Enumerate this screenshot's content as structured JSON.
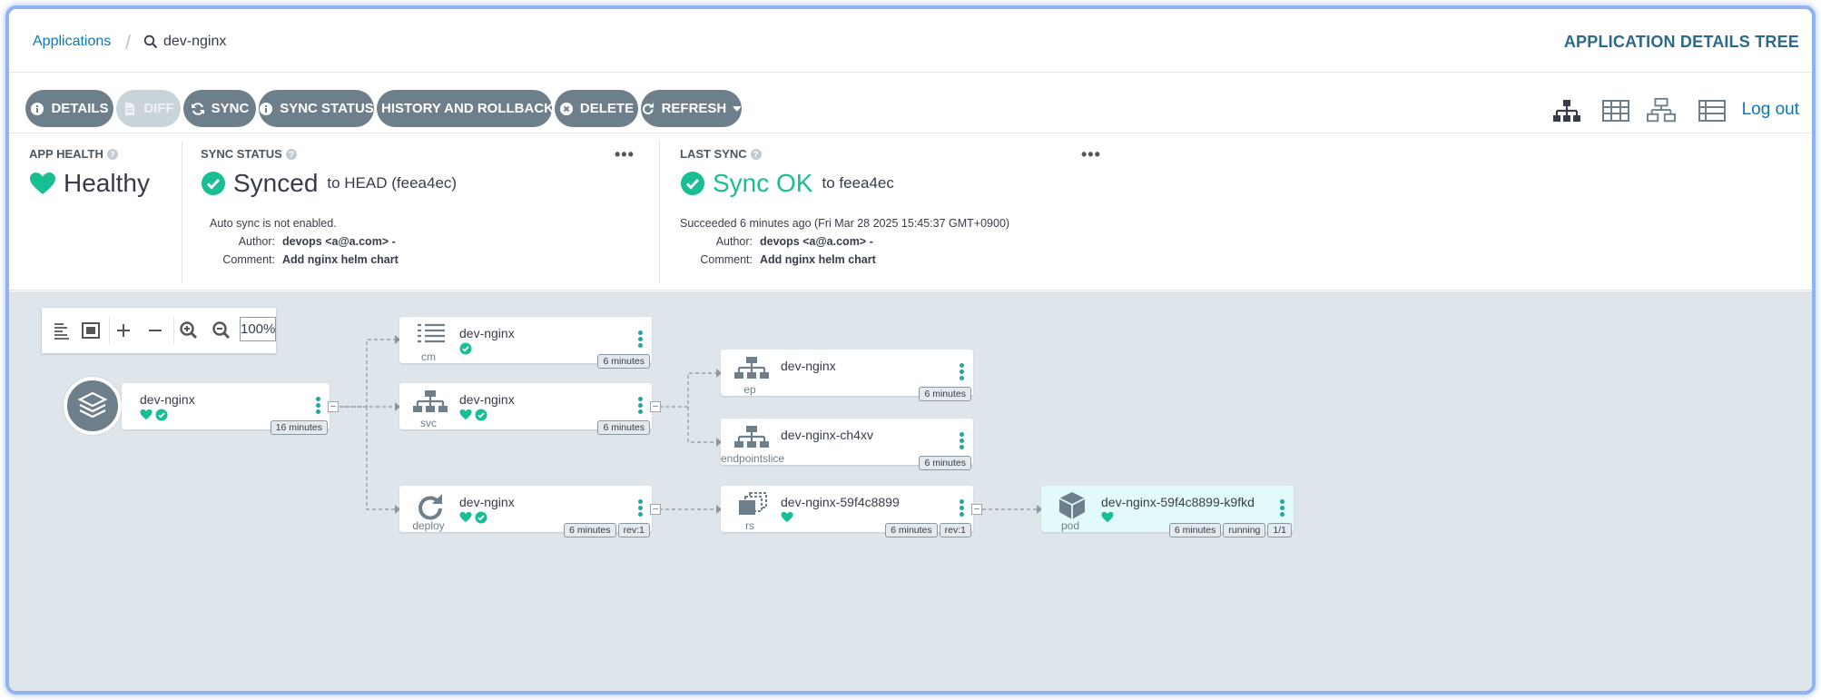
{
  "breadcrumb": {
    "root": "Applications",
    "current": "dev-nginx"
  },
  "page_title": "APPLICATION DETAILS TREE",
  "toolbar": {
    "details": "DETAILS",
    "diff": "DIFF",
    "sync": "SYNC",
    "sync_status": "SYNC STATUS",
    "history": "HISTORY AND ROLLBACK",
    "delete": "DELETE",
    "refresh": "REFRESH",
    "logout": "Log out"
  },
  "status": {
    "app_health": {
      "title": "APP HEALTH",
      "value": "Healthy"
    },
    "sync_status": {
      "title": "SYNC STATUS",
      "value": "Synced",
      "target": "to HEAD (feea4ec)",
      "note": "Auto sync is not enabled.",
      "author_label": "Author:",
      "author": "devops <a@a.com> -",
      "comment_label": "Comment:",
      "comment": "Add nginx helm chart"
    },
    "last_sync": {
      "title": "LAST SYNC",
      "value": "Sync OK",
      "target": "to feea4ec",
      "note": "Succeeded 6 minutes ago (Fri Mar 28 2025 15:45:37 GMT+0900)",
      "author_label": "Author:",
      "author": "devops <a@a.com> -",
      "comment_label": "Comment:",
      "comment": "Add nginx helm chart"
    },
    "more": "•••"
  },
  "zoom": {
    "level": "100%"
  },
  "nodes": {
    "app": {
      "name": "dev-nginx",
      "age": "16 minutes"
    },
    "cm": {
      "name": "dev-nginx",
      "kind": "cm",
      "age": "6 minutes"
    },
    "svc": {
      "name": "dev-nginx",
      "kind": "svc",
      "age": "6 minutes"
    },
    "deploy": {
      "name": "dev-nginx",
      "kind": "deploy",
      "age": "6 minutes",
      "rev": "rev:1"
    },
    "ep": {
      "name": "dev-nginx",
      "kind": "ep",
      "age": "6 minutes"
    },
    "eps": {
      "name": "dev-nginx-ch4xv",
      "kind": "endpointslice",
      "age": "6 minutes"
    },
    "rs": {
      "name": "dev-nginx-59f4c8899",
      "kind": "rs",
      "age": "6 minutes",
      "rev": "rev:1"
    },
    "pod": {
      "name": "dev-nginx-59f4c8899-k9fkd",
      "kind": "pod",
      "age": "6 minutes",
      "state": "running",
      "ready": "1/1"
    }
  },
  "colors": {
    "healthy": "#18be94",
    "accent": "#23a5a8",
    "button": "#6d7f8b",
    "canvas": "#dee6eb"
  }
}
